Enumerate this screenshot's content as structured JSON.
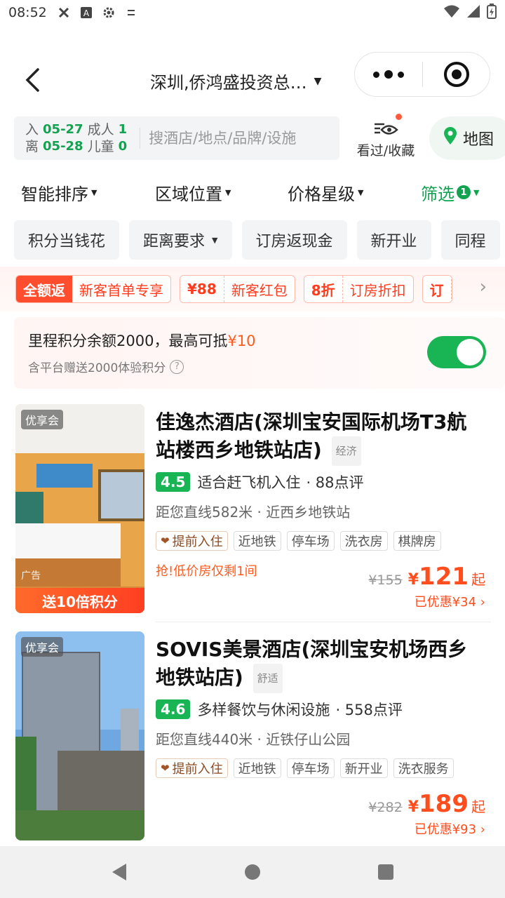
{
  "status_bar": {
    "time": "08:52"
  },
  "header": {
    "location": "深圳,侨鸿盛投资总…"
  },
  "search": {
    "checkin_label": "入",
    "checkin_date": "05-27",
    "checkout_label": "离",
    "checkout_date": "05-28",
    "adults_label": "成人",
    "adults": "1",
    "children_label": "儿童",
    "children": "0",
    "placeholder": "搜酒店/地点/品牌/设施",
    "history_label": "看过/收藏",
    "map_label": "地图"
  },
  "filters": {
    "sort": "智能排序",
    "area": "区域位置",
    "price": "价格星级",
    "screen": "筛选",
    "screen_count": "1"
  },
  "chips": [
    "积分当钱花",
    "距离要求",
    "订房返现金",
    "新开业",
    "同程"
  ],
  "promos": [
    {
      "lead": "全额返",
      "text": "新客首单专享"
    },
    {
      "lead": "¥88",
      "text": "新客红包"
    },
    {
      "lead": "8折",
      "text": "订房折扣"
    },
    {
      "lead": "订",
      "text": ""
    }
  ],
  "mileage": {
    "line1_prefix": "里程积分余额2000，最高可抵",
    "line1_amount": "¥10",
    "line2": "含平台赠送2000体验积分",
    "toggle_on": true
  },
  "hotels": [
    {
      "member_badge": "优享会",
      "ad_label": "广告",
      "bonus": "送10倍积分",
      "name": "佳逸杰酒店(深圳宝安国际机场T3航站楼西乡地铁站店)",
      "grade": "经济",
      "score": "4.5",
      "highlight": "适合赶飞机入住",
      "reviews": "· 88点评",
      "distance": "距您直线582米 · 近西乡地铁站",
      "tags": [
        "提前入住",
        "近地铁",
        "停车场",
        "洗衣房",
        "棋牌房"
      ],
      "urgent": "抢!低价房仅剩1间",
      "old_price": "¥155",
      "currency": "¥",
      "price": "121",
      "price_suffix": "起",
      "saved": "已优惠¥34"
    },
    {
      "member_badge": "优享会",
      "name": "SOVIS美景酒店(深圳宝安机场西乡地铁站店)",
      "grade": "舒适",
      "score": "4.6",
      "highlight": "多样餐饮与休闲设施",
      "reviews": "· 558点评",
      "distance": "距您直线440米 · 近铁仔山公园",
      "tags": [
        "提前入住",
        "近地铁",
        "停车场",
        "新开业",
        "洗衣服务"
      ],
      "old_price": "¥282",
      "currency": "¥",
      "price": "189",
      "price_suffix": "起",
      "saved": "已优惠¥93"
    }
  ],
  "colors": {
    "brand_green": "#12a351",
    "price_orange": "#ff4d1e",
    "promo_red": "#ff3c1e"
  }
}
